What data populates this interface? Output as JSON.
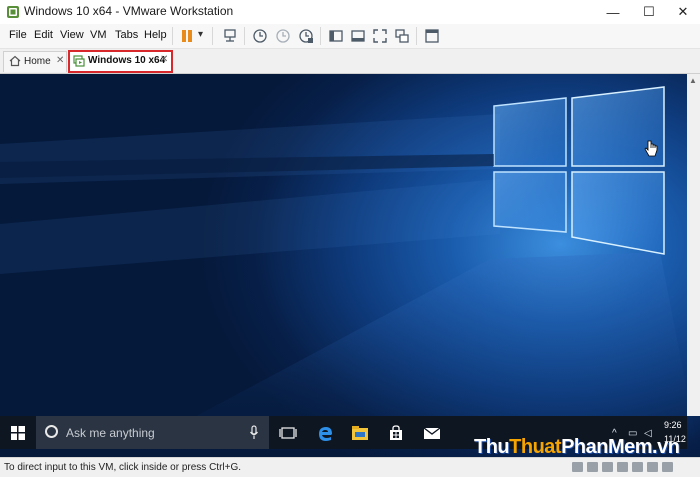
{
  "window": {
    "title": "Windows 10 x64 - VMware Workstation",
    "controls": {
      "minimize": "—",
      "maximize": "☐",
      "close": "✕"
    }
  },
  "menu": {
    "items": [
      "File",
      "Edit",
      "View",
      "VM",
      "Tabs",
      "Help"
    ]
  },
  "toolbar": {
    "pause_dropdown": "▾"
  },
  "tabs": [
    {
      "label": "Home",
      "close": "✕"
    },
    {
      "label": "Windows 10 x64",
      "close": "✕"
    }
  ],
  "guest_taskbar": {
    "search_placeholder": "Ask me anything",
    "time": "9:26",
    "date": "11/12"
  },
  "statusbar": {
    "text": "To direct input to this VM, click inside or press Ctrl+G."
  },
  "watermark": {
    "part1": "Thu",
    "part2": "Thuat",
    "part3": "PhanMem.vn"
  },
  "colors": {
    "tab_highlight": "#d9282b",
    "desktop_blue": "#1a5cad",
    "taskbar": "#0e1622"
  }
}
